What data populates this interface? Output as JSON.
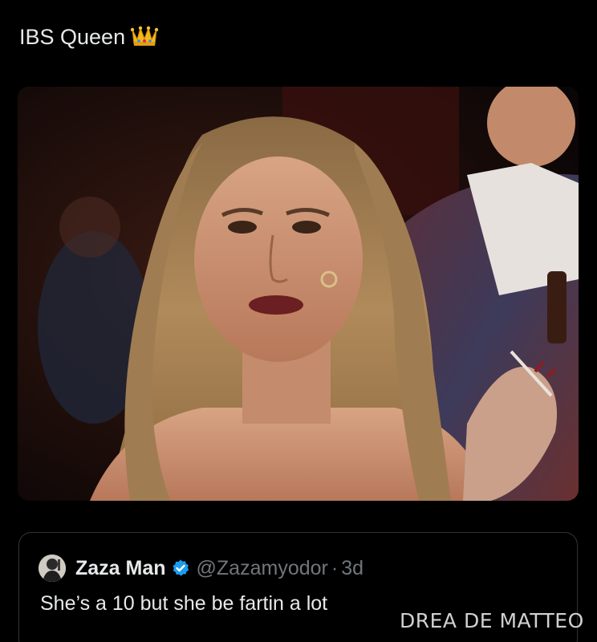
{
  "tweet": {
    "text": "IBS Queen",
    "emoji": "👑",
    "emoji_name": "crown-icon"
  },
  "media": {
    "description_icon": "photo"
  },
  "quote": {
    "display_name": "Zaza Man",
    "verified_icon": "verified-badge-icon",
    "verified_color": "#1d9bf0",
    "handle": "@Zazamyodor",
    "separator": "·",
    "age": "3d",
    "text": "She’s a 10 but she be fartin a lot"
  },
  "watermark": {
    "text": "DREA DE MATTEO"
  }
}
